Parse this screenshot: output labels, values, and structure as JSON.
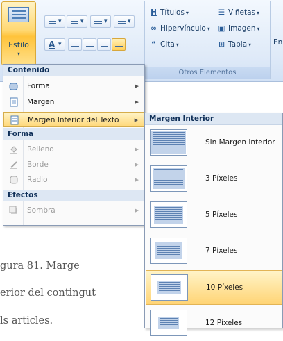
{
  "ribbon": {
    "estilo_label": "Estilo",
    "estilo_arrow": "▾",
    "group_otros_label": "Otros Elementos",
    "items": {
      "titulos": "Títulos",
      "vinetas": "Viñetas",
      "hipervinculo": "Hipervínculo",
      "imagen": "Imagen",
      "cita": "Cita",
      "tabla": "Tabla"
    },
    "dropdown_arrow": "▾",
    "extra_label": "En",
    "text_color_glyph": "A"
  },
  "menu": {
    "sections": {
      "contenido": "Contenido",
      "forma": "Forma",
      "efectos": "Efectos"
    },
    "items": {
      "forma": "Forma",
      "margen": "Margen",
      "margen_interior": "Margen Interior del Texto",
      "relleno": "Relleno",
      "borde": "Borde",
      "radio": "Radio",
      "sombra": "Sombra"
    },
    "submenu_arrow": "▶"
  },
  "submenu": {
    "header": "Margen Interior",
    "options": [
      "Sin Margen Interior",
      "3 Píxeles",
      "5 Píxeles",
      "7 Píxeles",
      "10 Píxeles",
      "12 Píxeles"
    ],
    "selected_index": 4
  },
  "caption": {
    "line1": "gura 81. Marge",
    "line2": "erior del contingut",
    "line3": "ls articles."
  },
  "colors": {
    "accent_hover": "#ffd475",
    "ribbon_bg": "#dfeaf8",
    "header_text": "#0f2f58"
  }
}
